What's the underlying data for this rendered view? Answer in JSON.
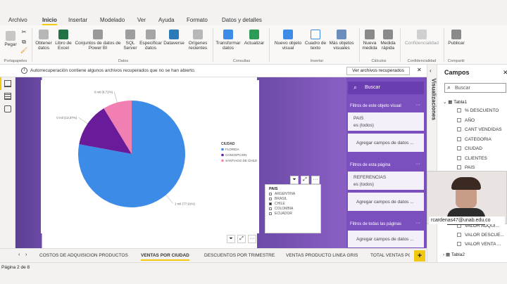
{
  "ribbon": {
    "tabs": [
      "Archivo",
      "Inicio",
      "Insertar",
      "Modelado",
      "Ver",
      "Ayuda",
      "Formato",
      "Datos y detalles"
    ],
    "buttons": {
      "paste": "Pegar",
      "get_data": "Obtener datos",
      "excel": "Libro de Excel",
      "powerbi_datasets": "Conjuntos de datos de Power BI",
      "sql": "SQL Server",
      "enter_data": "Especificar datos",
      "dataverse": "Dataverse",
      "recent_sources": "Orígenes recientes",
      "transform": "Transformar datos",
      "refresh": "Actualizar",
      "new_visual": "Nuevo objeto visual",
      "text_box": "Cuadro de texto",
      "more_visuals": "Más objetos visuales",
      "new_measure": "Nueva medida",
      "quick_measure": "Medida rápida",
      "sensitivity": "Confidencialidad",
      "publish": "Publicar"
    },
    "groups": {
      "clipboard": "Portapapeles",
      "data": "Datos",
      "queries": "Consultas",
      "insert": "Insertar",
      "calculations": "Cálculos",
      "sensitivity": "Confidencialidad",
      "share": "Compartir"
    }
  },
  "infobar": {
    "message": "Autorrecuperación contiene algunos archivos recuperados que no se han abierto.",
    "button": "Ver archivos recuperados",
    "close": "✕"
  },
  "chart_data": {
    "type": "pie",
    "title": "",
    "legend_title": "CIUDAD",
    "categories": [
      "FLORIDA",
      "CONCEPCION",
      "SANTIAGO DE CHILE"
    ],
    "values": [
      77.91,
      13.37,
      8.72
    ],
    "data_labels": [
      "1 mil (77,91%)",
      "0 mil (13,37%)",
      "0 mil (8,72%)"
    ],
    "colors": [
      "#3c8ce7",
      "#6a1b9a",
      "#f27fb2"
    ],
    "legend_position": "right"
  },
  "slicer": {
    "title": "PAIS",
    "options": [
      {
        "label": "ARGENTINA",
        "checked": false
      },
      {
        "label": "BRASIL",
        "checked": false
      },
      {
        "label": "CHILE",
        "checked": true
      },
      {
        "label": "COLOMBIA",
        "checked": false
      },
      {
        "label": "ECUADOR",
        "checked": false
      }
    ]
  },
  "filters": {
    "search_placeholder": "Buscar",
    "visual_header": "Filtros de este objeto visual",
    "pais_name": "PAIS",
    "pais_value": "es (todos)",
    "add_fields_1": "Agregar campos de datos ...",
    "page_header": "Filtros de esta página",
    "ref_name": "REFERENCIAS",
    "ref_value": "es (todos)",
    "add_fields_2": "Agregar campos de datos ...",
    "all_pages_header": "Filtros de todas las páginas",
    "add_fields_3": "Agregar campos de datos ...",
    "more": "···"
  },
  "visualizaciones": {
    "label": "Visualizaciones"
  },
  "campos": {
    "title": "Campos",
    "search_placeholder": "Buscar",
    "table1": "Tabla1",
    "fields": [
      "% DESCUENTO",
      "AÑO",
      "CANT VENDIDAS",
      "CATEGORIA",
      "CIUDAD",
      "CLIENTES",
      "PAIS"
    ],
    "bottom_fields": [
      "VALOR ADQUI...",
      "VALOR DESCUE...",
      "VALOR VENTA ..."
    ],
    "table2": "Tabla2"
  },
  "webcam": {
    "email": "rcardenas47@unab.edu.co"
  },
  "page_tabs": {
    "tabs": [
      "COSTOS DE ADQUISICION PRODUCTOS",
      "VENTAS POR CIUDAD",
      "DESCUENTOS POR TRIMESTRE",
      "VENTAS PRODUCTO LINEA GRIS",
      "TOTAL VENTAS POR"
    ],
    "active_index": 1,
    "add": "+"
  },
  "status": {
    "page": "Página 2 de 8"
  },
  "colors": {
    "accent": "#f2c811",
    "filters_bg": "#7c4fbe",
    "canvas_purple": "#6c4aa6"
  }
}
